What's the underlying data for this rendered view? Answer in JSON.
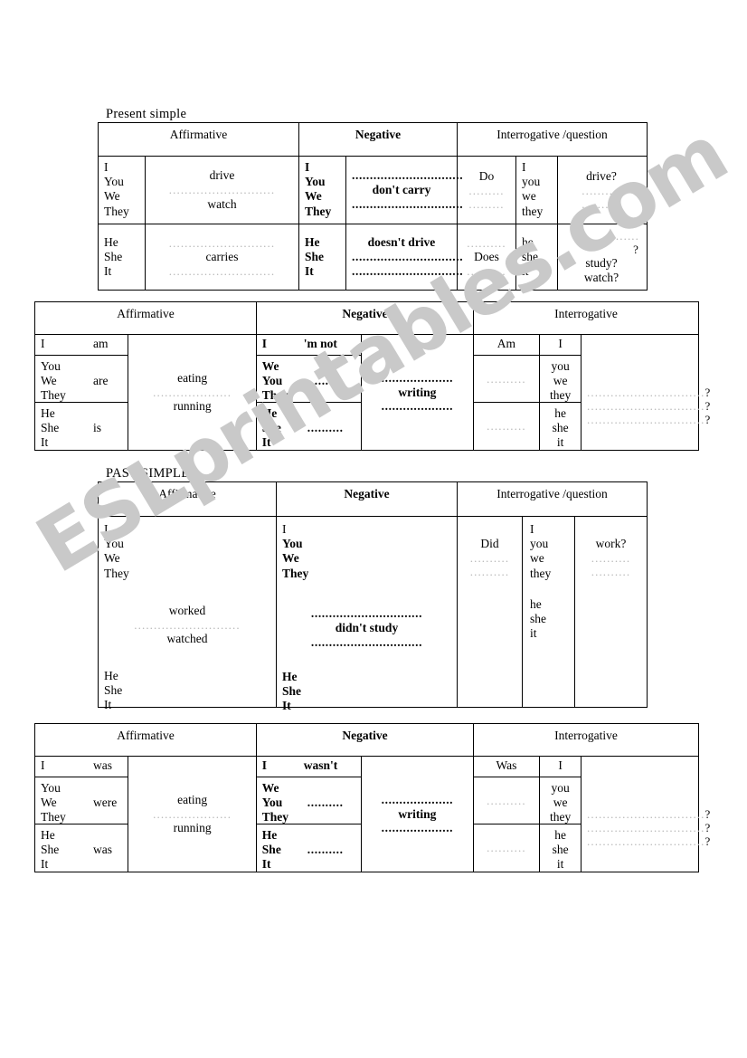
{
  "watermark": "ESLprintables.com",
  "sections": [
    {
      "title": "Present simple",
      "headers": {
        "affirmative": "Affirmative",
        "negative": "Negative",
        "interrogative": "Interrogative /question"
      },
      "rows": [
        {
          "aff_pronouns": [
            "I",
            "You",
            "We",
            "They"
          ],
          "aff_verbs": [
            "drive",
            "watch"
          ],
          "neg_pronouns": [
            "I",
            "You",
            "We",
            "They"
          ],
          "neg_verb": "don't carry",
          "int_aux": "Do",
          "int_pronouns": [
            "I",
            "you",
            "we",
            "they"
          ],
          "int_verbs": [
            "drive?"
          ]
        },
        {
          "aff_pronouns": [
            "He",
            "She",
            "It"
          ],
          "aff_verbs": [
            "carries"
          ],
          "neg_pronouns": [
            "He",
            "She",
            "It"
          ],
          "neg_verb": "doesn't drive",
          "int_aux": "Does",
          "int_pronouns": [
            "he",
            "she",
            "it"
          ],
          "int_verbs": [
            "study?",
            "watch?"
          ]
        }
      ]
    },
    {
      "title": "",
      "headers": {
        "affirmative": "Affirmative",
        "negative": "Negative",
        "interrogative": "Interrogative"
      },
      "aff": {
        "r1_pronoun": "I",
        "r1_be": "am",
        "r2_pronouns": [
          "You",
          "We",
          "They"
        ],
        "r2_be": "are",
        "r3_pronouns": [
          "He",
          "She",
          "It"
        ],
        "r3_be": "is",
        "verbs": [
          "eating",
          "running"
        ]
      },
      "neg": {
        "r1_pronoun": "I",
        "r1_be": "'m not",
        "r2_pronouns": [
          "We",
          "You",
          "They"
        ],
        "r3_pronouns": [
          "He",
          "She",
          "It"
        ],
        "verb": "writing"
      },
      "int": {
        "aux": "Am",
        "r1_pronoun": "I",
        "r2_pronouns": [
          "you",
          "we",
          "they"
        ],
        "r3_pronouns": [
          "he",
          "she",
          "it"
        ]
      }
    },
    {
      "title": "PAST SIMPLE",
      "headers": {
        "affirmative": "Affirmative",
        "negative": "Negative",
        "interrogative": "Interrogative /question"
      },
      "aff": {
        "pronouns_top": [
          "I",
          "You",
          "We",
          "They"
        ],
        "verbs": [
          "worked",
          "watched"
        ],
        "pronouns_bottom": [
          "He",
          "She",
          "It"
        ]
      },
      "neg": {
        "pronouns_top": [
          "I",
          "You",
          "We",
          "They"
        ],
        "verb": "didn't study",
        "pronouns_bottom": [
          "He",
          "She",
          "It"
        ]
      },
      "int": {
        "aux": "Did",
        "pronouns_top": [
          "I",
          "you",
          "we",
          "they"
        ],
        "pronouns_bottom": [
          "he",
          "she",
          "it"
        ],
        "verb": "work?"
      }
    },
    {
      "title": "",
      "headers": {
        "affirmative": "Affirmative",
        "negative": "Negative",
        "interrogative": "Interrogative"
      },
      "aff": {
        "r1_pronoun": "I",
        "r1_be": "was",
        "r2_pronouns": [
          "You",
          "We",
          "They"
        ],
        "r2_be": "were",
        "r3_pronouns": [
          "He",
          "She",
          "It"
        ],
        "r3_be": "was",
        "verbs": [
          "eating",
          "running"
        ]
      },
      "neg": {
        "r1_pronoun": "I",
        "r1_be": "wasn't",
        "r2_pronouns": [
          "We",
          "You",
          "They"
        ],
        "r3_pronouns": [
          "He",
          "She",
          "It"
        ],
        "verb": "writing"
      },
      "int": {
        "aux": "Was",
        "r1_pronoun": "I",
        "r2_pronouns": [
          "you",
          "we",
          "they"
        ],
        "r3_pronouns": [
          "he",
          "she",
          "it"
        ]
      }
    }
  ],
  "fillers": {
    "dots_long": "...........................",
    "dots_med": "....................",
    "dots_short": "..........",
    "dots_xshort": ".........",
    "dots_bold_long": "...............................",
    "dots_bold_med": "....................",
    "dots_q": "..............................",
    "question_mark": "?"
  }
}
